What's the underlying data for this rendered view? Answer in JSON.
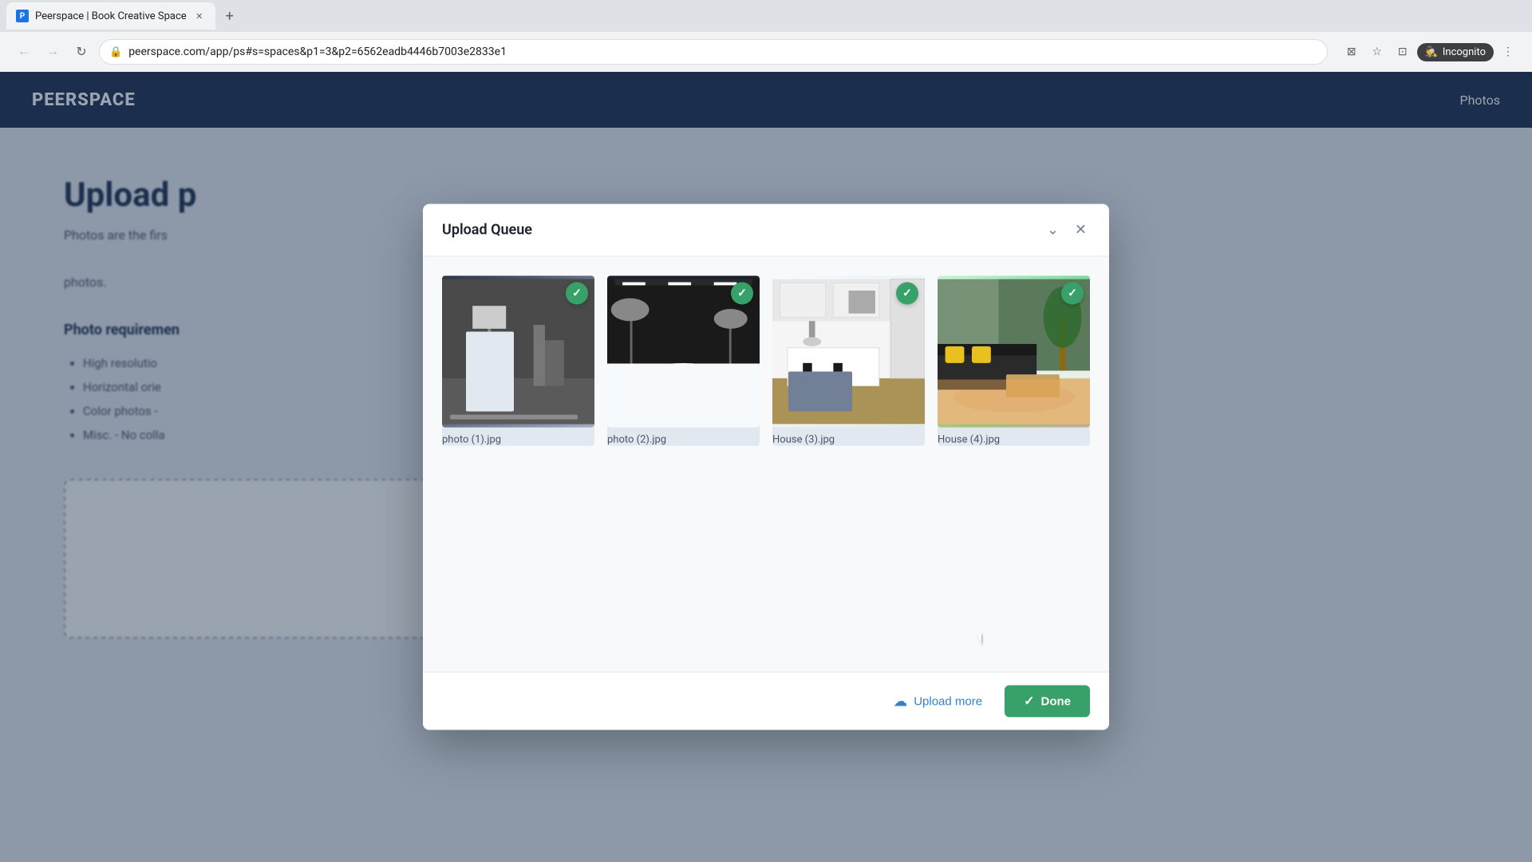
{
  "browser": {
    "tab_title": "Peerspace | Book Creative Space",
    "tab_favicon": "P",
    "address": "peerspace.com/app/ps#s=spaces&p1=3&p2=6562eadb4446b7003e2833e1",
    "incognito_label": "Incognito",
    "new_tab_label": "+"
  },
  "page": {
    "header": {
      "logo": "PEERSPACE",
      "nav_link": "Photos"
    },
    "title": "Upload p",
    "subtitle": "Photos are the firs",
    "body_text": "photos.",
    "section_title": "Photo requiremen",
    "bullets": [
      "High resolutio",
      "Horizontal orie",
      "Color photos -",
      "Misc. - No colla"
    ]
  },
  "modal": {
    "title": "Upload Queue",
    "minimize_icon": "chevron-down",
    "close_icon": "close",
    "photos": [
      {
        "id": 1,
        "filename": "photo (1).jpg",
        "status": "success",
        "thumb_type": "studio1"
      },
      {
        "id": 2,
        "filename": "photo (2).jpg",
        "status": "success",
        "thumb_type": "studio2"
      },
      {
        "id": 3,
        "filename": "House (3).jpg",
        "status": "success",
        "thumb_type": "kitchen"
      },
      {
        "id": 4,
        "filename": "House (4).jpg",
        "status": "success",
        "thumb_type": "living"
      }
    ],
    "footer": {
      "upload_more_label": "Upload more",
      "done_label": "Done"
    }
  }
}
